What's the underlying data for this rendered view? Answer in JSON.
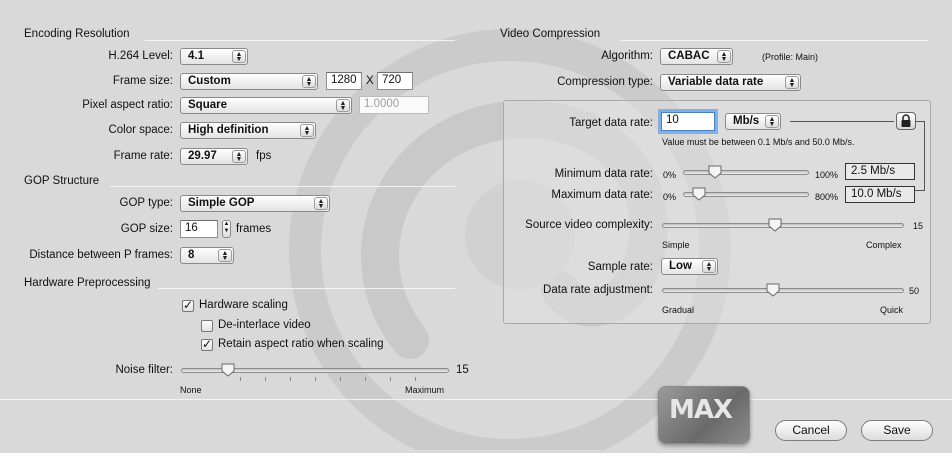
{
  "encoding": {
    "title": "Encoding Resolution",
    "h264_level_label": "H.264 Level:",
    "h264_level_value": "4.1",
    "frame_size_label": "Frame size:",
    "frame_size_value": "Custom",
    "width_value": "1280",
    "x_label": "X",
    "height_value": "720",
    "pixel_aspect_label": "Pixel aspect ratio:",
    "pixel_aspect_value": "Square",
    "pixel_aspect_number": "1.0000",
    "color_space_label": "Color space:",
    "color_space_value": "High definition",
    "frame_rate_label": "Frame rate:",
    "frame_rate_value": "29.97",
    "fps_label": "fps"
  },
  "gop": {
    "title": "GOP Structure",
    "type_label": "GOP type:",
    "type_value": "Simple GOP",
    "size_label": "GOP size:",
    "size_value": "16",
    "frames_label": "frames",
    "distance_label": "Distance between P frames:",
    "distance_value": "8"
  },
  "hardware": {
    "title": "Hardware Preprocessing",
    "hardware_scaling_label": "Hardware scaling",
    "hardware_scaling_checked": true,
    "deinterlace_label": "De-interlace video",
    "deinterlace_checked": false,
    "retain_aspect_label": "Retain aspect ratio when scaling",
    "retain_aspect_checked": true,
    "noise_filter_label": "Noise filter:",
    "noise_filter_value": 1,
    "noise_filter_max_label": "15",
    "noise_min_label": "None",
    "noise_max_label": "Maximum"
  },
  "compression": {
    "title": "Video Compression",
    "algorithm_label": "Algorithm:",
    "algorithm_value": "CABAC",
    "profile_text": "(Profile: Main)",
    "type_label": "Compression type:",
    "type_value": "Variable data rate",
    "target_label": "Target data rate:",
    "target_value": "10",
    "target_unit": "Mb/s",
    "validation_text": "Value must be between 0.1 Mb/s and 50.0 Mb/s.",
    "min_label": "Minimum data rate:",
    "min_left": "0%",
    "min_right": "100%",
    "min_value_text": "2.5 Mb/s",
    "min_percent": 25,
    "max_label": "Maximum data rate:",
    "max_left": "0%",
    "max_right": "800%",
    "max_value_text": "10.0 Mb/s",
    "max_percent": 100,
    "complexity_label": "Source video complexity:",
    "complexity_value": 7,
    "complexity_max": "15",
    "complexity_left": "Simple",
    "complexity_right": "Complex",
    "sample_rate_label": "Sample rate:",
    "sample_rate_value": "Low",
    "adjustment_label": "Data rate adjustment:",
    "adjustment_value": 23,
    "adjustment_max": "50",
    "adjustment_left": "Gradual",
    "adjustment_right": "Quick"
  },
  "footer": {
    "logo_text": "MAX",
    "cancel_label": "Cancel",
    "save_label": "Save"
  },
  "colors": {
    "background": "#d9d9d9",
    "focus_ring": "#7fb0e6",
    "logo": "#7a7a7a"
  }
}
